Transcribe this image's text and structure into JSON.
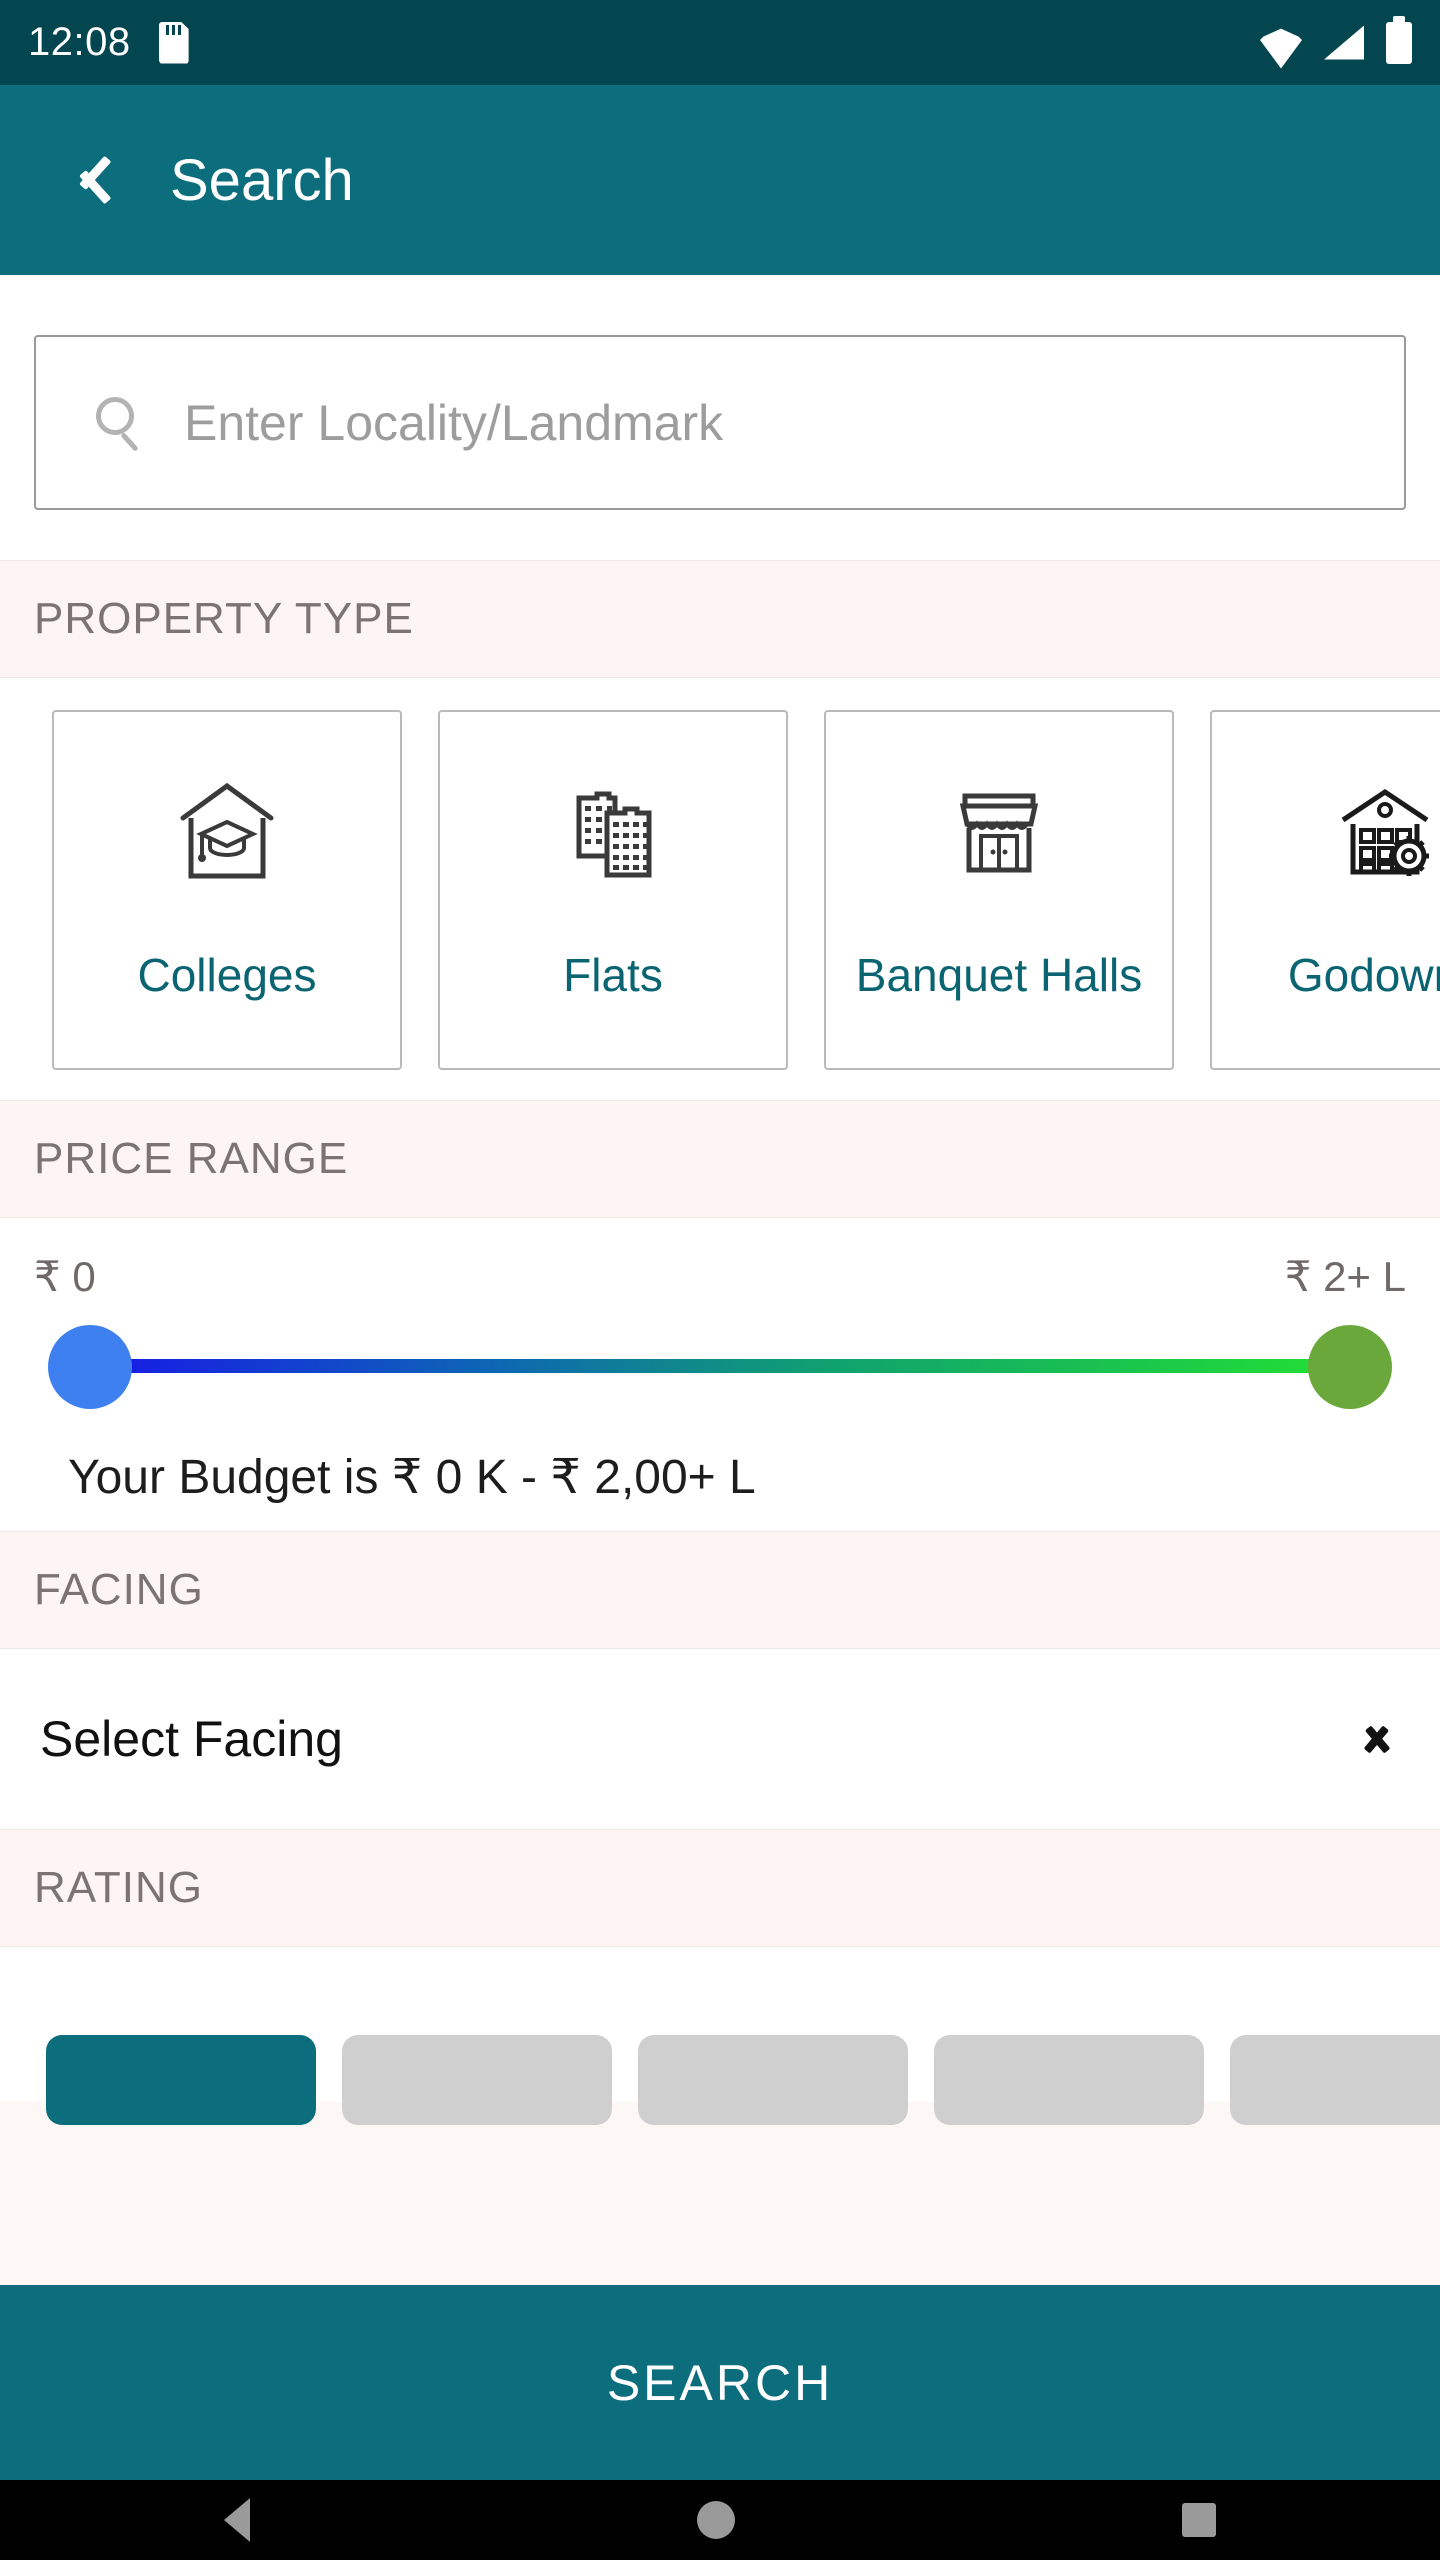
{
  "status_bar": {
    "time": "12:08",
    "sd_card_icon": "sd-card-icon",
    "wifi_icon": "wifi-icon",
    "signal_icon": "cellular-signal-icon",
    "battery_icon": "battery-full-icon"
  },
  "app_bar": {
    "back_icon": "back-chevron-icon",
    "title": "Search"
  },
  "search": {
    "icon": "search-icon",
    "placeholder": "Enter Locality/Landmark",
    "value": ""
  },
  "property_type": {
    "section_label": "PROPERTY TYPE",
    "cards": [
      {
        "label": "Colleges",
        "icon": "college-house-graduation-cap-icon"
      },
      {
        "label": "Flats",
        "icon": "apartment-buildings-icon"
      },
      {
        "label": "Banquet Halls",
        "icon": "storefront-awning-icon"
      },
      {
        "label": "Godowns",
        "icon": "warehouse-gear-icon"
      }
    ]
  },
  "price_range": {
    "section_label": "PRICE RANGE",
    "min_label": "₹ 0",
    "max_label": "₹ 2+ L",
    "budget_text": "Your Budget is ₹ 0 K - ₹ 2,00+ L",
    "left_thumb_color": "#3f80f0",
    "right_thumb_color": "#6aa83c",
    "track_start_color": "#1818e8",
    "track_end_color": "#22e033"
  },
  "facing": {
    "section_label": "FACING",
    "selected": "Select Facing",
    "chevron_icon": "chevron-down-icon"
  },
  "rating": {
    "section_label": "RATING",
    "pills": [
      {
        "selected": true
      },
      {
        "selected": false
      },
      {
        "selected": false
      },
      {
        "selected": false
      },
      {
        "selected": false
      }
    ],
    "selected_color": "#0c6d7d",
    "unselected_color": "#cfcfcf"
  },
  "search_button": {
    "label": "SEARCH",
    "color": "#0c6d7d"
  },
  "nav_bar": {
    "back_icon": "nav-back-icon",
    "home_icon": "nav-home-icon",
    "recents_icon": "nav-recents-icon"
  },
  "theme": {
    "status_bar_color": "#034650",
    "primary": "#0c6d7d",
    "accent_text": "#0a6472",
    "tint_band": "#fdf5f3"
  }
}
